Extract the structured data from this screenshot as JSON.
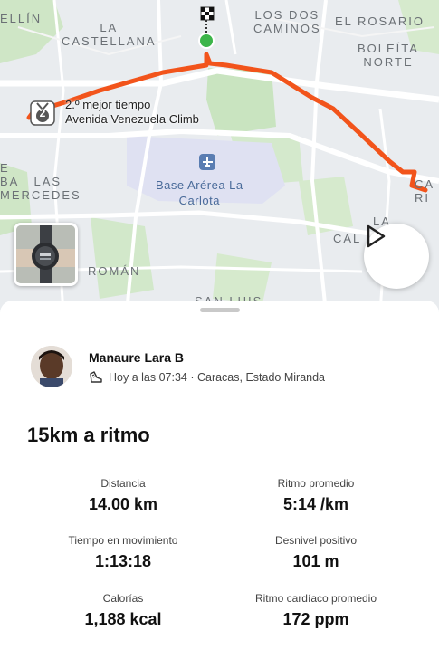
{
  "map": {
    "labels": {
      "ellin": "ELLÍN",
      "la_castellana": "LA\nCASTELLANA",
      "los_dos_caminos": "LOS DOS\nCAMINOS",
      "el_rosario": "EL ROSARIO",
      "boleita_norte": "BOLEÍTA\nNORTE",
      "las_mercedes": "E      \nBA   LAS\nMERCEDES",
      "cal": "CAL",
      "ca_ri": "CA\nRI",
      "la_small": "LA",
      "roman": "ROMÁN",
      "san_luis": "SAN LUIS"
    },
    "airport_label": "Base Arérea La\nCarlota",
    "segment": {
      "rank_badge": "2",
      "line1": "2.º mejor tiempo",
      "line2": "Avenida Venezuela Climb"
    },
    "colors": {
      "route": "#f2541b",
      "start": "#3cb54a",
      "park": "#c9e4c0"
    }
  },
  "media": {
    "play_icon": "play-icon"
  },
  "athlete": {
    "name": "Manaure Lara B",
    "activity_icon": "shoe-icon",
    "meta": "Hoy a las 07:34 · Caracas, Estado Miranda"
  },
  "activity": {
    "title": "15km a ritmo"
  },
  "stats": {
    "distance": {
      "label": "Distancia",
      "value": "14.00 km"
    },
    "pace": {
      "label": "Ritmo promedio",
      "value": "5:14 /km"
    },
    "moving_time": {
      "label": "Tiempo en movimiento",
      "value": "1:13:18"
    },
    "elevation": {
      "label": "Desnivel positivo",
      "value": "101 m"
    },
    "calories": {
      "label": "Calorías",
      "value": "1,188 kcal"
    },
    "heart_rate": {
      "label": "Ritmo cardíaco promedio",
      "value": "172 ppm"
    }
  }
}
